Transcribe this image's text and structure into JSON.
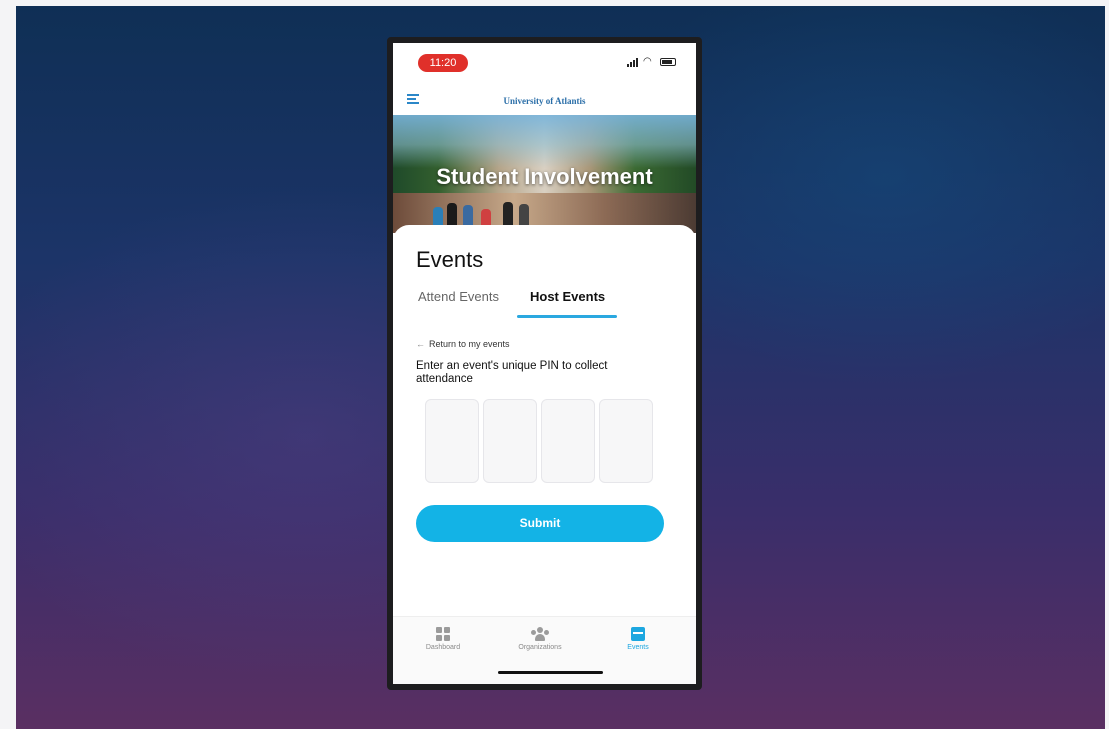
{
  "status_bar": {
    "time": "11:20"
  },
  "app_bar": {
    "brand": "University of Atlantis"
  },
  "hero": {
    "title": "Student Involvement"
  },
  "page": {
    "title": "Events"
  },
  "tabs": [
    {
      "label": "Attend Events",
      "selected": false
    },
    {
      "label": "Host Events",
      "selected": true
    }
  ],
  "back_link": {
    "label": "Return to my events"
  },
  "instructions": "Enter an event's unique PIN to collect attendance",
  "pin": {
    "digits": [
      "",
      "",
      "",
      ""
    ]
  },
  "submit_label": "Submit",
  "bottom_nav": [
    {
      "label": "Dashboard",
      "icon": "dashboard-icon",
      "active": false
    },
    {
      "label": "Organizations",
      "icon": "organizations-icon",
      "active": false
    },
    {
      "label": "Events",
      "icon": "events-icon",
      "active": true
    }
  ],
  "colors": {
    "accent": "#13b3e6",
    "time_pill": "#e0302a",
    "brand": "#2a6ea8"
  }
}
